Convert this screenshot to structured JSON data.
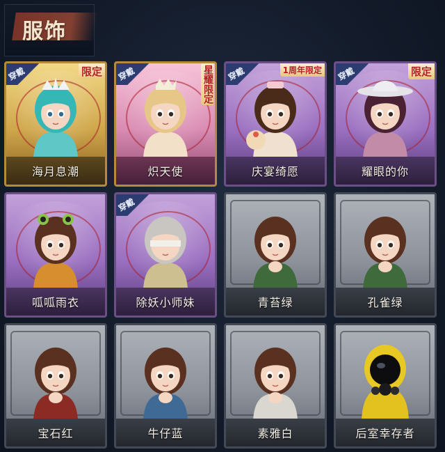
{
  "header": {
    "title": "服饰"
  },
  "wear_label": "穿戴",
  "cards": [
    {
      "name": "海月息潮",
      "theme": "gold",
      "worn": true,
      "tag": "限定",
      "tag_style": "normal",
      "figure": "teal-hair"
    },
    {
      "name": "炽天使",
      "theme": "pink",
      "worn": true,
      "tag": "星耀限定",
      "tag_style": "vertical",
      "figure": "blonde-angel"
    },
    {
      "name": "庆宴绮愿",
      "theme": "purple",
      "worn": true,
      "tag": "1周年限定",
      "tag_style": "small",
      "figure": "party-girl"
    },
    {
      "name": "耀眼的你",
      "theme": "purple",
      "worn": true,
      "tag": "限定",
      "tag_style": "normal",
      "figure": "cowgirl"
    },
    {
      "name": "呱呱雨衣",
      "theme": "purple",
      "worn": false,
      "tag": "",
      "tag_style": "",
      "figure": "frog-hood"
    },
    {
      "name": "除妖小师妹",
      "theme": "purple",
      "worn": true,
      "tag": "",
      "tag_style": "",
      "figure": "blindfold"
    },
    {
      "name": "青苔绿",
      "theme": "grey",
      "worn": false,
      "tag": "",
      "tag_style": "",
      "figure": "girl-green"
    },
    {
      "name": "孔雀绿",
      "theme": "grey",
      "worn": false,
      "tag": "",
      "tag_style": "",
      "figure": "girl-green"
    },
    {
      "name": "宝石红",
      "theme": "grey",
      "worn": false,
      "tag": "",
      "tag_style": "",
      "figure": "girl-red"
    },
    {
      "name": "牛仔蓝",
      "theme": "grey",
      "worn": false,
      "tag": "",
      "tag_style": "",
      "figure": "girl-blue"
    },
    {
      "name": "素雅白",
      "theme": "grey",
      "worn": false,
      "tag": "",
      "tag_style": "",
      "figure": "girl-white"
    },
    {
      "name": "后室幸存者",
      "theme": "grey",
      "worn": false,
      "tag": "",
      "tag_style": "",
      "figure": "hazmat"
    }
  ]
}
